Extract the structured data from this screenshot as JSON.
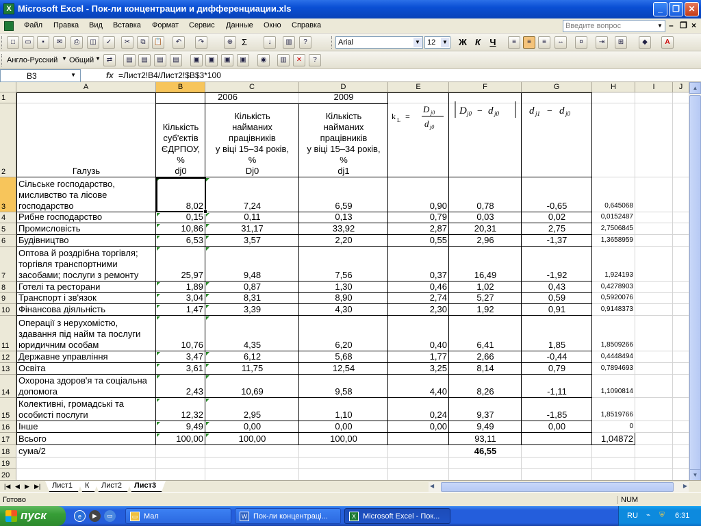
{
  "window": {
    "title": "Microsoft Excel - Пок-ли концентрации и дифференциации.xls",
    "app_icon_label": "X"
  },
  "menu": {
    "items": [
      "Файл",
      "Правка",
      "Вид",
      "Вставка",
      "Формат",
      "Сервис",
      "Данные",
      "Окно",
      "Справка"
    ],
    "question_placeholder": "Введите вопрос"
  },
  "toolbar": {
    "font_name": "Arial",
    "font_size": "12",
    "bold_label": "Ж",
    "italic_label": "К",
    "underline_label": "Ч",
    "sum_label": "Σ",
    "language_label": "Англо-Русский",
    "dictionary_label": "Общий"
  },
  "formula_bar": {
    "name_box": "B3",
    "fx_label": "fx",
    "formula": "=Лист2!B4/Лист2!$B$3*100"
  },
  "columns": [
    "A",
    "B",
    "C",
    "D",
    "E",
    "F",
    "G",
    "H",
    "I",
    "J"
  ],
  "selected_column": "B",
  "selected_row": "3",
  "header": {
    "year_2006": "2006",
    "year_2009": "2009",
    "col_a": "Галузь",
    "col_b_lines": [
      "Кількість",
      "суб'єктів",
      "ЄДРПОУ,",
      "%",
      "dj0"
    ],
    "col_c_lines": [
      "Кількість",
      "найманих",
      "працівників",
      "у віці 15–34 років,",
      "%",
      "Dj0"
    ],
    "col_d_lines": [
      "Кількість",
      "найманих",
      "працівників",
      "у віці 15–34 років,",
      "%",
      "dj1"
    ],
    "col_e_formula": "k_L = D_j0 / d_j0",
    "col_f_formula": "|D_j0 − d_j0|",
    "col_g_formula": "d_j1 − d_j0"
  },
  "rows": [
    {
      "num": "3",
      "a": "Сільське господарство, мисливство та лісове господарство",
      "b": "8,02",
      "c": "7,24",
      "d": "6,59",
      "e": "0,90",
      "f": "0,78",
      "g": "-0,65",
      "h": "0,645068"
    },
    {
      "num": "4",
      "a": "Рибне господарство",
      "b": "0,15",
      "c": "0,11",
      "d": "0,13",
      "e": "0,79",
      "f": "0,03",
      "g": "0,02",
      "h": "0,0152487"
    },
    {
      "num": "5",
      "a": "Промисловість",
      "b": "10,86",
      "c": "31,17",
      "d": "33,92",
      "e": "2,87",
      "f": "20,31",
      "g": "2,75",
      "h": "2,7506845"
    },
    {
      "num": "6",
      "a": "Будівництво",
      "b": "6,53",
      "c": "3,57",
      "d": "2,20",
      "e": "0,55",
      "f": "2,96",
      "g": "-1,37",
      "h": "1,3658959"
    },
    {
      "num": "7",
      "a": "Оптова й роздрібна торгівля; торгівля транспортними засобами; послуги з ремонту",
      "b": "25,97",
      "c": "9,48",
      "d": "7,56",
      "e": "0,37",
      "f": "16,49",
      "g": "-1,92",
      "h": "1,924193"
    },
    {
      "num": "8",
      "a": "Готелі та ресторани",
      "b": "1,89",
      "c": "0,87",
      "d": "1,30",
      "e": "0,46",
      "f": "1,02",
      "g": "0,43",
      "h": "0,4278903"
    },
    {
      "num": "9",
      "a": "Транспорт і зв'язок",
      "b": "3,04",
      "c": "8,31",
      "d": "8,90",
      "e": "2,74",
      "f": "5,27",
      "g": "0,59",
      "h": "0,5920076"
    },
    {
      "num": "10",
      "a": "Фінансова діяльність",
      "b": "1,47",
      "c": "3,39",
      "d": "4,30",
      "e": "2,30",
      "f": "1,92",
      "g": "0,91",
      "h": "0,9148373"
    },
    {
      "num": "11",
      "a": "Операції з нерухомістю, здавання під найм та послуги юридичним особам",
      "b": "10,76",
      "c": "4,35",
      "d": "6,20",
      "e": "0,40",
      "f": "6,41",
      "g": "1,85",
      "h": "1,8509266"
    },
    {
      "num": "12",
      "a": "Державне управління",
      "b": "3,47",
      "c": "6,12",
      "d": "5,68",
      "e": "1,77",
      "f": "2,66",
      "g": "-0,44",
      "h": "0,4448494"
    },
    {
      "num": "13",
      "a": "Освіта",
      "b": "3,61",
      "c": "11,75",
      "d": "12,54",
      "e": "3,25",
      "f": "8,14",
      "g": "0,79",
      "h": "0,7894693"
    },
    {
      "num": "14",
      "a": "Охорона здоров'я та соціальна допомога",
      "b": "2,43",
      "c": "10,69",
      "d": "9,58",
      "e": "4,40",
      "f": "8,26",
      "g": "-1,11",
      "h": "1,1090814"
    },
    {
      "num": "15",
      "a": "Колективні, громадські та особисті послуги",
      "b": "12,32",
      "c": "2,95",
      "d": "1,10",
      "e": "0,24",
      "f": "9,37",
      "g": "-1,85",
      "h": "1,8519766"
    },
    {
      "num": "16",
      "a": "Інше",
      "b": "9,49",
      "c": "0,00",
      "d": "0,00",
      "e": "0,00",
      "f": "9,49",
      "g": "0,00",
      "h": "0"
    },
    {
      "num": "17",
      "a": "Всього",
      "b": "100,00",
      "c": "100,00",
      "d": "100,00",
      "e": "",
      "f": "93,11",
      "g": "",
      "h": "1,04872"
    },
    {
      "num": "18",
      "a": "сума/2",
      "b": "",
      "c": "",
      "d": "",
      "e": "",
      "f": "46,55",
      "g": "",
      "h": ""
    },
    {
      "num": "19",
      "a": "",
      "b": "",
      "c": "",
      "d": "",
      "e": "",
      "f": "",
      "g": "",
      "h": ""
    },
    {
      "num": "20",
      "a": "",
      "b": "",
      "c": "",
      "d": "",
      "e": "",
      "f": "",
      "g": "",
      "h": ""
    }
  ],
  "sheet_tabs": [
    "Лист1",
    "К",
    "Лист2",
    "Лист3"
  ],
  "active_tab": "Лист3",
  "status": {
    "ready": "Готово",
    "num": "NUM"
  },
  "taskbar": {
    "start_label": "пуск",
    "tasks": [
      "Мал",
      "Пок-ли концентраці...",
      "Microsoft Excel - Пок..."
    ],
    "lang": "RU",
    "clock": "6:31"
  }
}
